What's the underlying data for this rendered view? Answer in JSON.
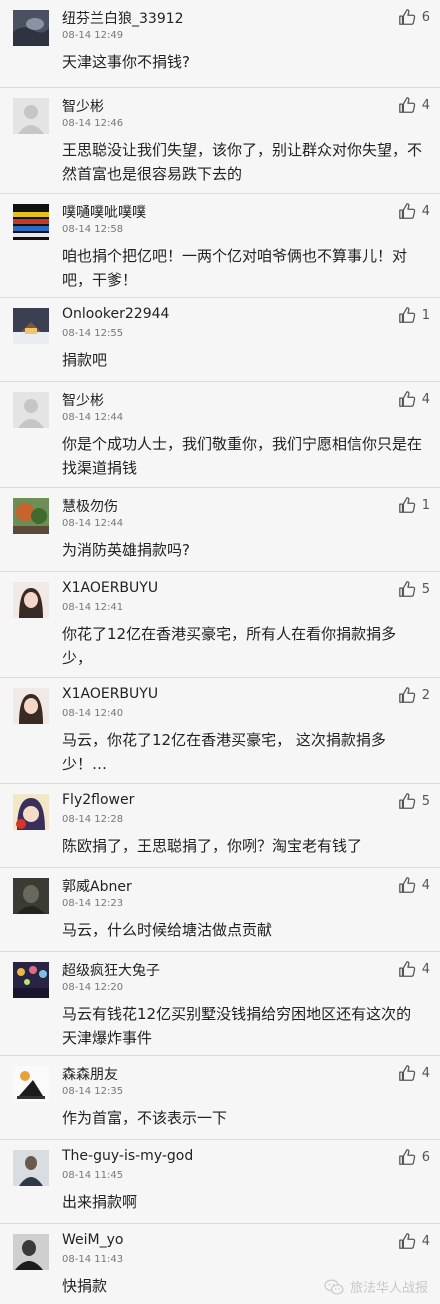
{
  "comments": [
    {
      "user": "纽芬兰白狼_33912",
      "time": "08-14 12:49",
      "likes": "6",
      "text": "天津这事你不捐钱?",
      "avatar": "dark-blanket-avatar"
    },
    {
      "user": "智少彬",
      "time": "08-14 12:46",
      "likes": "4",
      "text": "王思聪没让我们失望，该你了，别让群众对你失望，不然首富也是很容易跌下去的",
      "avatar": "default-avatar"
    },
    {
      "user": "噗嗵噗呲噗噗",
      "time": "08-14 12:58",
      "likes": "4",
      "text": "咱也捐个把亿吧！一两个亿对咱爷俩也不算事儿！对吧，干爹！",
      "avatar": "striped-avatar"
    },
    {
      "user": "Onlooker22944",
      "time": "08-14 12:55",
      "likes": "1",
      "text": "捐款吧",
      "avatar": "snow-house-avatar"
    },
    {
      "user": "智少彬",
      "time": "08-14 12:44",
      "likes": "4",
      "text": "你是个成功人士，我们敬重你，我们宁愿相信你只是在找渠道捐钱",
      "avatar": "default-avatar"
    },
    {
      "user": "慧极勿伤",
      "time": "08-14 12:44",
      "likes": "1",
      "text": "为消防英雄捐款吗?",
      "avatar": "garden-avatar"
    },
    {
      "user": "X1AOERBUYU",
      "time": "08-14 12:41",
      "likes": "5",
      "text": "你花了12亿在香港买豪宅，所有人在看你捐款捐多少，",
      "avatar": "girl-avatar"
    },
    {
      "user": "X1AOERBUYU",
      "time": "08-14 12:40",
      "likes": "2",
      "text": "马云，你花了12亿在香港买豪宅， 这次捐款捐多少！…",
      "avatar": "girl-avatar"
    },
    {
      "user": "Fly2flower",
      "time": "08-14 12:28",
      "likes": "5",
      "text": "陈欧捐了，王思聪捐了，你咧？淘宝老有钱了",
      "avatar": "anime-avatar"
    },
    {
      "user": "郭威Abner",
      "time": "08-14 12:23",
      "likes": "4",
      "text": "马云，什么时候给塘沽做点贡献",
      "avatar": "dark-man-avatar"
    },
    {
      "user": "超级疯狂大兔子",
      "time": "08-14 12:20",
      "likes": "4",
      "text": "马云有钱花12亿买别墅没钱捐给穷困地区还有这次的天津爆炸事件",
      "avatar": "lights-avatar"
    },
    {
      "user": "森森朋友",
      "time": "08-14 12:35",
      "likes": "4",
      "text": "作为首富，不该表示一下",
      "avatar": "piano-avatar"
    },
    {
      "user": "The-guy-is-my-god",
      "time": "08-14 11:45",
      "likes": "6",
      "text": "出来捐款啊",
      "avatar": "man-avatar"
    },
    {
      "user": "WeiM_yo",
      "time": "08-14 11:43",
      "likes": "4",
      "text": "快捐款",
      "avatar": "bw-avatar"
    }
  ],
  "watermark": {
    "text": "旅法华人战报",
    "icon": "wechat-icon"
  },
  "colors": {
    "background": "#f6f6f6",
    "divider": "#dcdcdc",
    "text": "#222222",
    "muted": "#777777"
  }
}
